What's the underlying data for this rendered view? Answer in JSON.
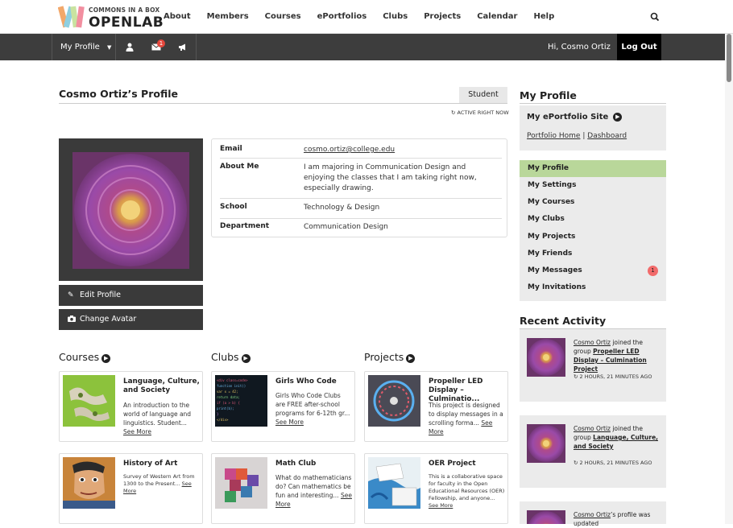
{
  "logo": {
    "top_text": "COMMONS IN A BOX",
    "main_text": "OPENLAB"
  },
  "nav": {
    "items": [
      "About",
      "Members",
      "Courses",
      "ePortfolios",
      "Clubs",
      "Projects",
      "Calendar",
      "Help",
      "My Profile"
    ],
    "active": "My Profile"
  },
  "adminbar": {
    "my_profile": "My Profile",
    "message_count": "1",
    "greeting": "Hi, Cosmo Ortiz",
    "logout": "Log Out"
  },
  "profile": {
    "title": "Cosmo Ortiz’s Profile",
    "member_type": "Student",
    "active_status": "ACTIVE RIGHT NOW",
    "edit_button": "Edit Profile",
    "avatar_button": "Change Avatar",
    "fields": [
      {
        "key": "Email",
        "value": "cosmo.ortiz@college.edu"
      },
      {
        "key": "About Me",
        "value": "I am majoring in Communication Design and enjoying the classes that I am taking right now, especially drawing."
      },
      {
        "key": "School",
        "value": "Technology & Design"
      },
      {
        "key": "Department",
        "value": "Communication Design"
      }
    ]
  },
  "sections": {
    "courses": {
      "title": "Courses",
      "cards": [
        {
          "title": "Language, Culture, and Society",
          "desc": "An introduction to the world of language and linguistics. Student...",
          "more": "See More"
        },
        {
          "title": "History of Art",
          "desc": "Survey of Western Art from 1300 to the Present...",
          "more": "See More"
        }
      ]
    },
    "clubs": {
      "title": "Clubs",
      "cards": [
        {
          "title": "Girls Who Code",
          "desc": "Girls Who Code Clubs are FREE after-school programs for 6-12th gr...",
          "more": "See More"
        },
        {
          "title": "Math Club",
          "desc": "What do mathematicians do? Can mathematics be fun and interesting...",
          "more": "See More"
        }
      ]
    },
    "projects": {
      "title": "Projects",
      "cards": [
        {
          "title": "Propeller LED Display – Culminatio...",
          "desc": "This project is designed to display messages in a scrolling forma...",
          "more": "See More"
        },
        {
          "title": "OER Project",
          "desc": "This is a collaborative space for faculty in the Open Educational Resources (OER) Fellowship, and anyone...",
          "more": "See More"
        }
      ]
    }
  },
  "sidebar": {
    "title": "My Profile",
    "eportfolio_title": "My ePortfolio Site",
    "portfolio_home": "Portfolio Home",
    "separator": "|",
    "dashboard": "Dashboard",
    "menu": [
      "My Profile",
      "My Settings",
      "My Courses",
      "My Clubs",
      "My Projects",
      "My Friends",
      "My Messages",
      "My Invitations"
    ],
    "messages_badge": "1",
    "recent_title": "Recent Activity",
    "activities": [
      {
        "user": "Cosmo Ortiz",
        "verb": " joined the group ",
        "target": "Propeller LED Display – Culmination Project",
        "time": "2 HOURS, 21 MINUTES AGO"
      },
      {
        "user": "Cosmo Ortiz",
        "verb": " joined the group ",
        "target": "Language, Culture, and Society",
        "time": "2 HOURS, 21 MINUTES AGO"
      },
      {
        "user": "Cosmo Ortiz",
        "verb": "’s profile was updated",
        "target": "",
        "time": ""
      }
    ]
  },
  "colors": {
    "accent_green": "#b9d79a",
    "dark_bar": "#3d3d3d",
    "badge_red": "#e4473c"
  }
}
